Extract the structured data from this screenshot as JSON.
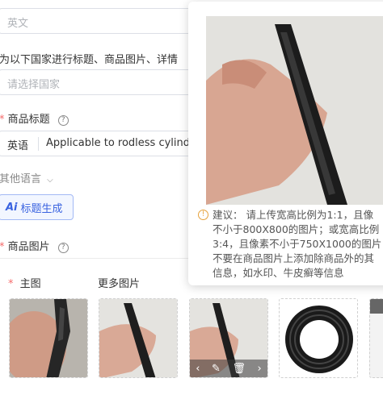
{
  "language_field": {
    "placeholder": "英文"
  },
  "country_hint": "为以下国家进行标题、商品图片、详情",
  "country_select": {
    "placeholder": "请选择国家"
  },
  "title_section": {
    "required_mark": "*",
    "label": "商品标题",
    "help_icon": "question-circle-icon",
    "language_tag": "英语",
    "value": "Applicable to rodless cylinde"
  },
  "other_languages": {
    "label": "其他语言",
    "icon": "chevron-down-icon"
  },
  "generate_button": {
    "ai_mark": "Ai",
    "label": "标题生成"
  },
  "images_section": {
    "required_mark": "*",
    "label": "商品图片",
    "help_icon": "question-circle-icon",
    "main_label": "主图",
    "more_label": "更多图片"
  },
  "thumbnails": [
    {
      "name": "main-image"
    },
    {
      "name": "hand-holding-strip"
    },
    {
      "name": "hand-holding-strip-active"
    },
    {
      "name": "coiled-strip"
    }
  ],
  "thumb_toolbar": {
    "prev_icon": "chevron-left-icon",
    "edit_icon": "pencil-icon",
    "delete_icon": "trash-icon",
    "next_icon": "chevron-right-icon"
  },
  "popover": {
    "icon": "info-circle-icon",
    "lines": [
      "建议：  请上传宽高比例为1:1，且像",
      "不小于800X800的图片；或宽高比例",
      "3:4，且像素不小于750X1000的图片，",
      "不要在商品图片上添加除商品外的其",
      "信息，如水印、牛皮癣等信息"
    ]
  },
  "colors": {
    "accent": "#3a63e0",
    "required": "#f56c6c",
    "warning": "#e6a23c",
    "border": "#dcdfe6"
  }
}
